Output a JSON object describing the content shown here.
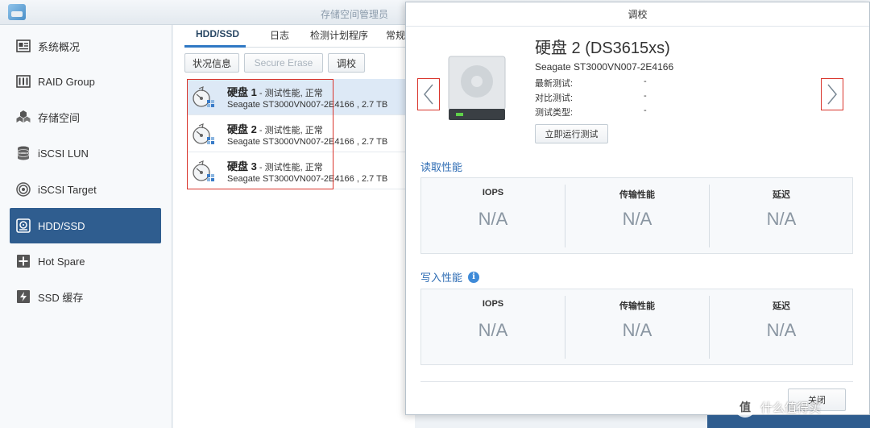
{
  "window": {
    "title": "存储空间管理员"
  },
  "sidebar": {
    "items": [
      {
        "label": "系统概况",
        "icon": "overview-icon"
      },
      {
        "label": "RAID Group",
        "icon": "raid-icon"
      },
      {
        "label": "存储空间",
        "icon": "volume-icon"
      },
      {
        "label": "iSCSI LUN",
        "icon": "lun-icon"
      },
      {
        "label": "iSCSI Target",
        "icon": "target-icon"
      },
      {
        "label": "HDD/SSD",
        "icon": "hdd-icon",
        "active": true
      },
      {
        "label": "Hot Spare",
        "icon": "hot-spare-icon"
      },
      {
        "label": "SSD 缓存",
        "icon": "ssd-cache-icon"
      }
    ]
  },
  "tabs": [
    {
      "label": "HDD/SSD",
      "active": true
    },
    {
      "label": "日志"
    },
    {
      "label": "检测计划程序"
    },
    {
      "label": "常规"
    }
  ],
  "toolbar": {
    "status_label": "状况信息",
    "secure_erase_label": "Secure Erase",
    "calibrate_label": "调校"
  },
  "disks": [
    {
      "name": "硬盘 1",
      "status": " - 测试性能, 正常",
      "model": "Seagate ST3000VN007-2E4166 , 2.7 TB",
      "selected": true
    },
    {
      "name": "硬盘 2",
      "status": " - 测试性能, 正常",
      "model": "Seagate ST3000VN007-2E4166 , 2.7 TB"
    },
    {
      "name": "硬盘 3",
      "status": " - 测试性能, 正常",
      "model": "Seagate ST3000VN007-2E4166 , 2.7 TB"
    }
  ],
  "dialog": {
    "title": "调校",
    "heading": "硬盘 2 (DS3615xs)",
    "model": "Seagate ST3000VN007-2E4166",
    "info": [
      {
        "label": "最新测试:",
        "value": "-"
      },
      {
        "label": "对比测试:",
        "value": "-"
      },
      {
        "label": "测试类型:",
        "value": "-"
      }
    ],
    "run_button": "立即运行测试",
    "read_section": "读取性能",
    "write_section": "写入性能",
    "columns": [
      "IOPS",
      "传输性能",
      "延迟"
    ],
    "read_values": [
      "N/A",
      "N/A",
      "N/A"
    ],
    "write_values": [
      "N/A",
      "N/A",
      "N/A"
    ],
    "close_button": "关闭"
  },
  "watermark": {
    "badge": "值",
    "text": "什么值得买"
  },
  "colors": {
    "accent": "#2f5d8f",
    "link": "#2f6db4",
    "highlight": "#d9342b"
  }
}
